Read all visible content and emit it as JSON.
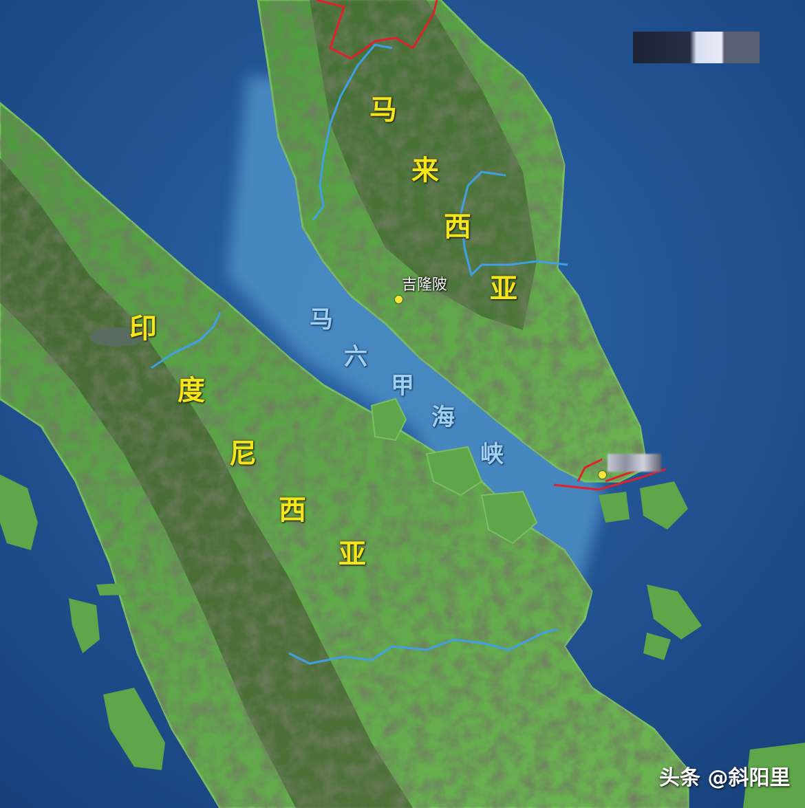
{
  "map": {
    "labels": {
      "malaysia": [
        "马",
        "来",
        "西",
        "亚"
      ],
      "indonesia": [
        "印",
        "度",
        "尼",
        "西",
        "亚"
      ],
      "strait": [
        "马",
        "六",
        "甲",
        "海",
        "峡"
      ],
      "kuala_lumpur": "吉隆陂"
    },
    "watermark": "头条 @斜阳里",
    "colors": {
      "sea": "#1f4f8f",
      "shallow_sea": "#4e8fc6",
      "land": "#5fa64a",
      "mountain": "#3d4a2c",
      "river": "#3fa0e6",
      "border": "#e0202a",
      "country_label": "#f5e51c",
      "strait_label": "#9fd2f2",
      "city_dot": "#f6e63a"
    },
    "icons": [
      "city-dot-icon"
    ]
  }
}
